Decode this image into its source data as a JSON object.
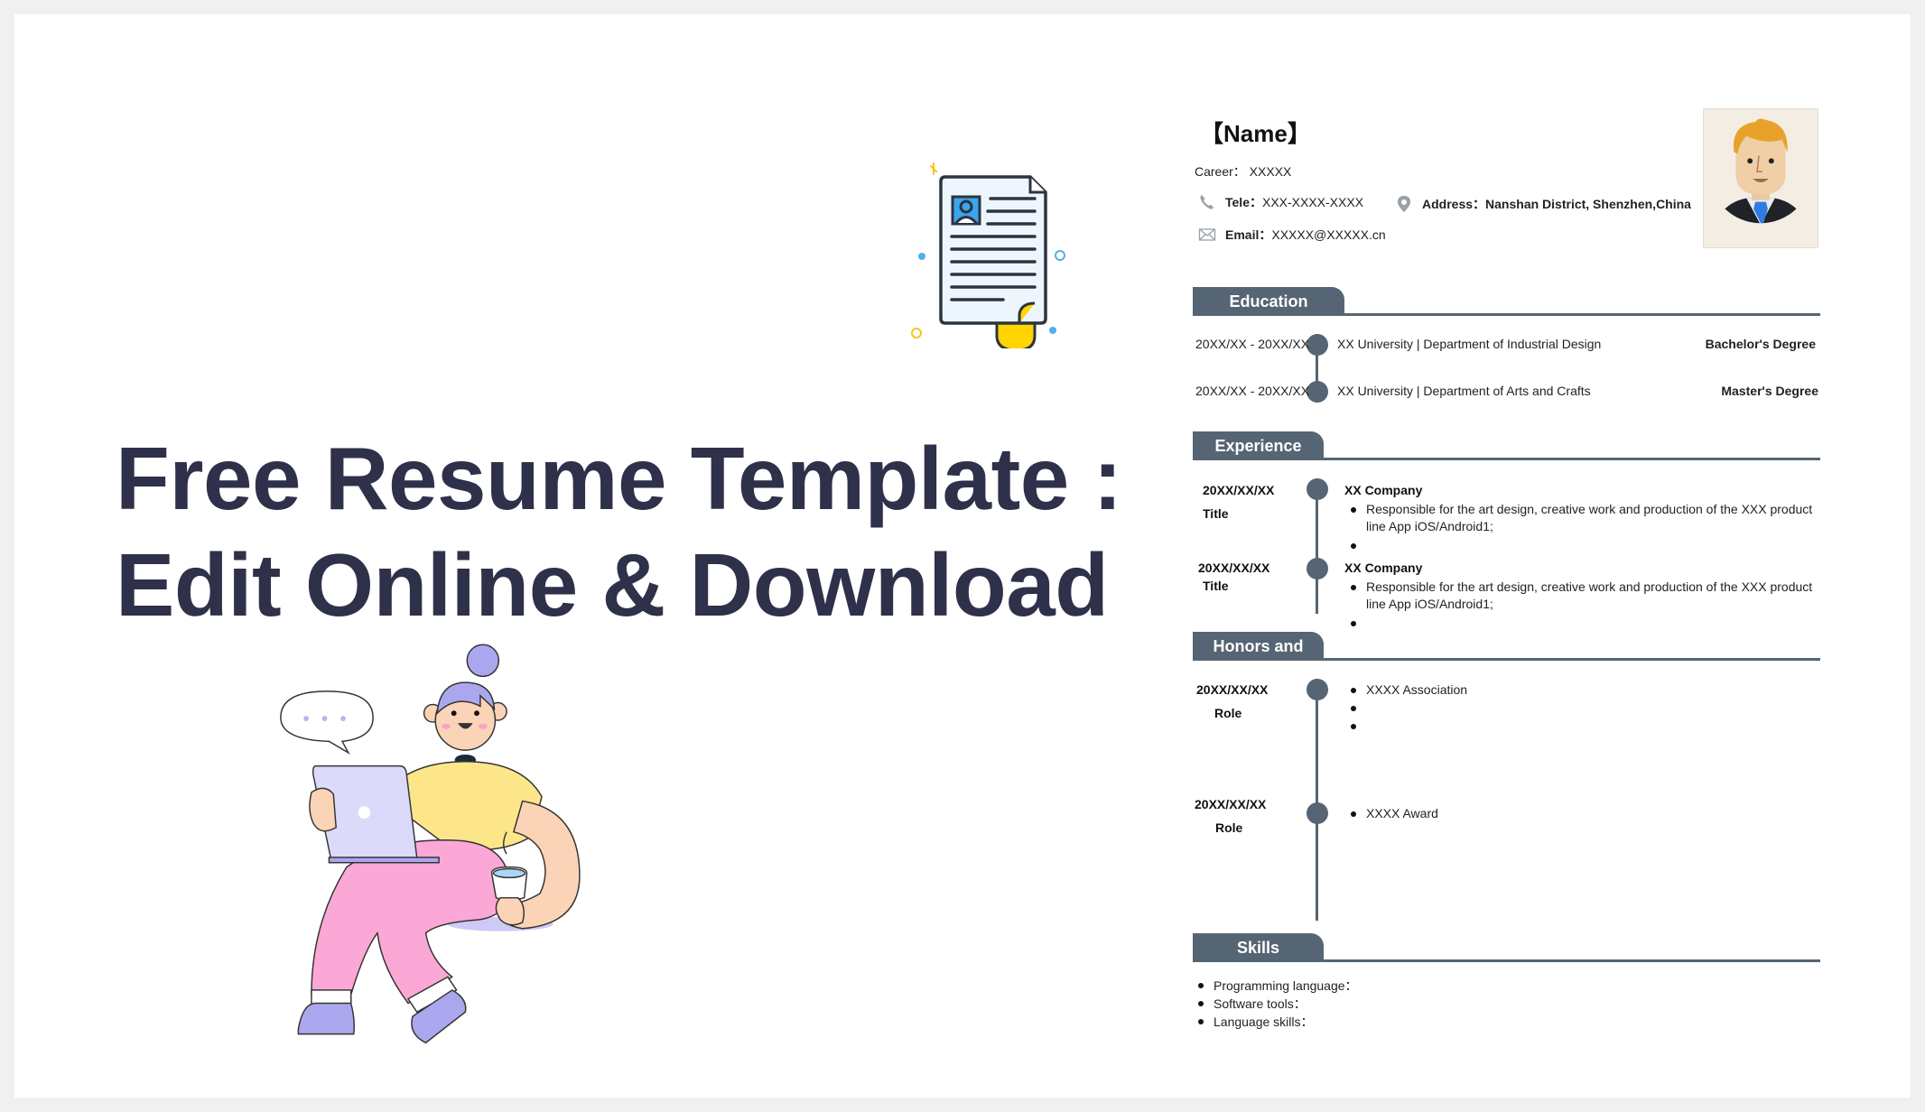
{
  "hero": {
    "title_line1": "Free Resume Template :",
    "title_line2": "Edit Online & Download",
    "text_color": "#2f3049"
  },
  "illustrations": {
    "document_icon": "resume-document-icon",
    "person": "person-with-laptop-illustration"
  },
  "resume": {
    "name": "【Name】",
    "career": "Career： XXXXX",
    "tele_label": "Tele：",
    "tele_value": "XXX-XXXX-XXXX",
    "address_label": "Address：",
    "address_value": "Nanshan District, Shenzhen,China",
    "email_label": "Email：",
    "email_value": "XXXXX@XXXXX.cn",
    "accent_color": "#566573",
    "sections": {
      "education": {
        "title": "Education",
        "rows": [
          {
            "date": "20XX/XX - 20XX/XX",
            "school": "XX University | Department of Industrial Design",
            "degree": "Bachelor's  Degree"
          },
          {
            "date": "20XX/XX - 20XX/XX",
            "school": "XX University | Department of Arts and Crafts",
            "degree": "Master's Degree"
          }
        ]
      },
      "experience": {
        "title": "Experience",
        "items": [
          {
            "date": "20XX/XX/XX",
            "title": "Title",
            "company": "XX Company",
            "bullets": [
              "Responsible for the art design, creative work and production of the XXX product line App iOS/Android1;",
              ""
            ]
          },
          {
            "date": "20XX/XX/XX",
            "title": "Title",
            "company": "XX Company",
            "bullets": [
              "Responsible for the art design, creative work and production of the XXX product line App iOS/Android1;",
              ""
            ]
          }
        ]
      },
      "honors": {
        "title": "Honors and",
        "items": [
          {
            "date": "20XX/XX/XX",
            "role": "Role",
            "bullets": [
              "XXXX Association",
              "",
              ""
            ]
          },
          {
            "date": "20XX/XX/XX",
            "role": "Role",
            "bullets": [
              "XXXX Award"
            ]
          }
        ]
      },
      "skills": {
        "title": "Skills",
        "items": [
          "Programming language：",
          "Software tools：",
          "Language skills："
        ]
      }
    }
  }
}
